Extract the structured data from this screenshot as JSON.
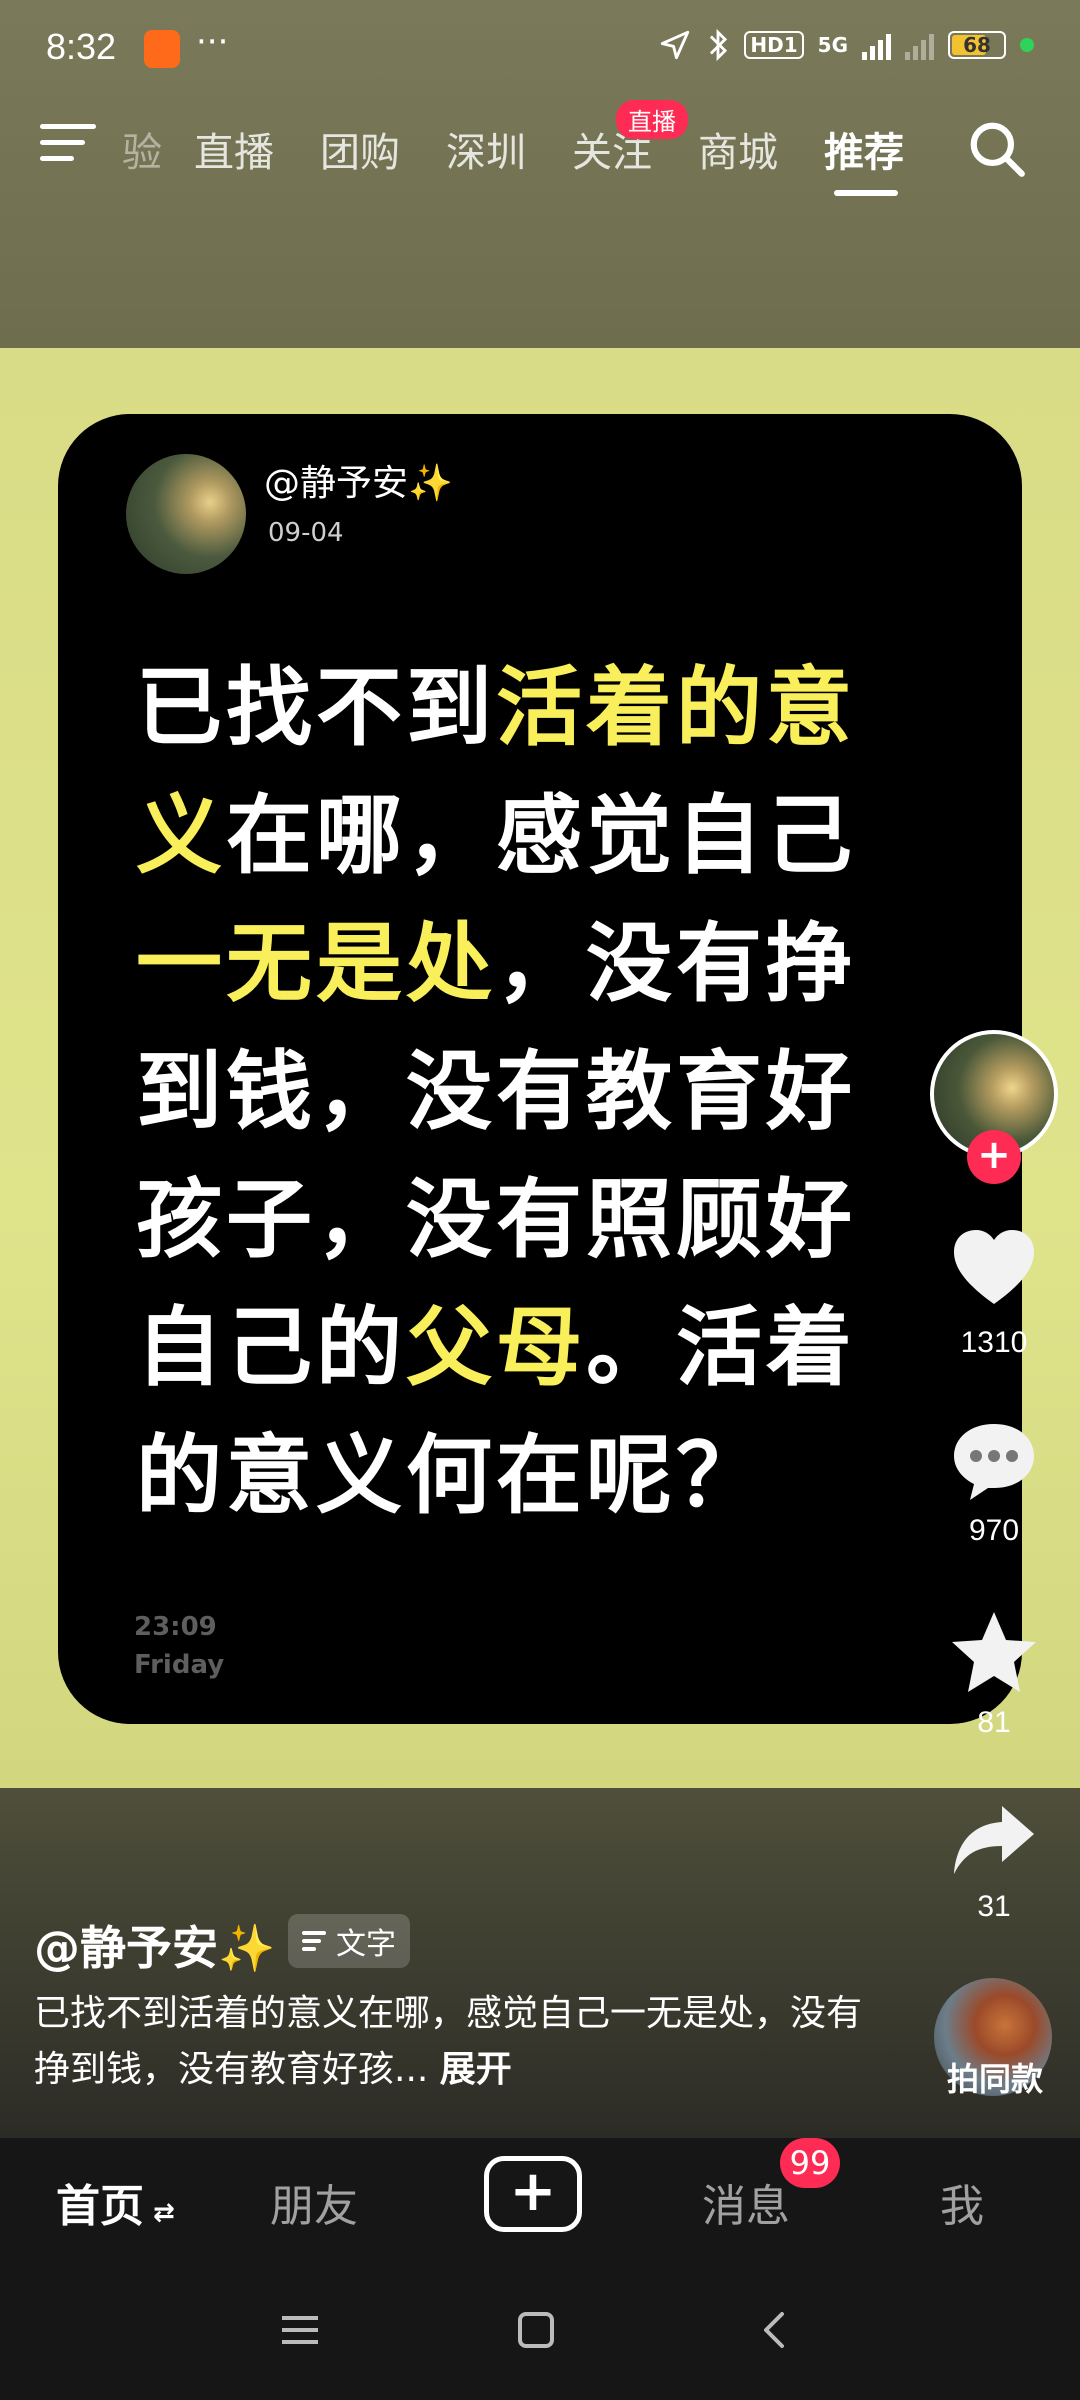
{
  "status": {
    "time": "8:32",
    "more": "···",
    "hd": "HD1",
    "network": "5G",
    "battery": "68",
    "battery_level": 0.68
  },
  "top_tabs": {
    "partial": "验",
    "items": [
      "直播",
      "团购",
      "深圳",
      "关注",
      "商城",
      "推荐"
    ],
    "active": "推荐",
    "live_badge": "直播"
  },
  "card": {
    "user": "@静予安✨",
    "date": "09-04",
    "text_segments": [
      {
        "t": "已找不到",
        "hl": false
      },
      {
        "t": "活着的意义",
        "hl": true
      },
      {
        "t": "在哪，感觉自己",
        "hl": false
      },
      {
        "t": "一无是处",
        "hl": true
      },
      {
        "t": "，没有挣到钱，没有教育好孩子，没有照顾好自己的",
        "hl": false
      },
      {
        "t": "父母",
        "hl": true
      },
      {
        "t": "。活着的意义何在呢？",
        "hl": false
      }
    ],
    "time": "23:09",
    "day": "Friday"
  },
  "rail": {
    "likes": "1310",
    "comments": "970",
    "favorites": "81",
    "shares": "31"
  },
  "caption": {
    "user": "@静予安✨",
    "tag": "文字",
    "text": "已找不到活着的意义在哪，感觉自己一无是处，没有挣到钱，没有教育好孩...",
    "more": "展开",
    "same_style": "拍同款"
  },
  "bottom_nav": {
    "home": "首页",
    "friends": "朋友",
    "messages": "消息",
    "messages_badge": "99",
    "me": "我"
  },
  "colors": {
    "highlight": "#f8ef5b",
    "accent": "#fe2c55"
  }
}
